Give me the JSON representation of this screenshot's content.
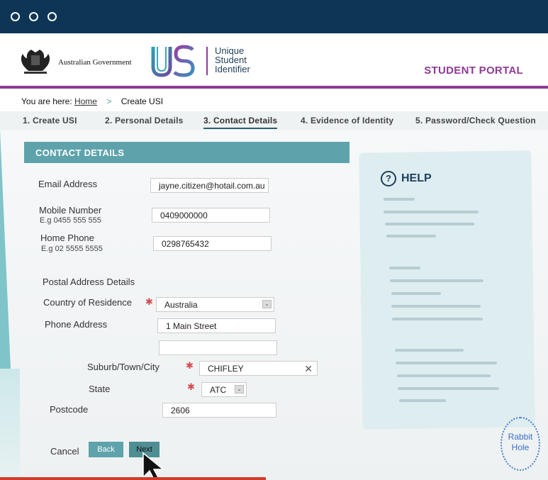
{
  "gov_label": "Australian Government",
  "logo": {
    "letters": "USI",
    "line1": "Unique",
    "line2": "Student",
    "line3": "Identifier"
  },
  "portal_title": "STUDENT PORTAL",
  "breadcrumb": {
    "prefix": "You are here:",
    "home": "Home",
    "separator": ">",
    "current": "Create USI"
  },
  "steps": [
    "1. Create USI",
    "2. Personal Details",
    "3. Contact Details",
    "4. Evidence of Identity",
    "5. Password/Check Question"
  ],
  "active_step": 2,
  "section_title": "CONTACT DETAILS",
  "form": {
    "email": {
      "label": "Email Address",
      "value": "jayne.citizen@hotail.com.au"
    },
    "mobile": {
      "label": "Mobile Number",
      "hint": "E.g 0455 555 555",
      "value": "0409000000"
    },
    "home_phone": {
      "label": "Home Phone",
      "hint": "E.g 02 5555 5555",
      "value": "0298765432"
    },
    "postal_heading": "Postal Address Details",
    "country": {
      "label": "Country of Residence",
      "value": "Australia"
    },
    "address": {
      "label": "Phone Address",
      "line1": "1 Main Street",
      "line2": ""
    },
    "suburb": {
      "label": "Suburb/Town/City",
      "value": "CHIFLEY"
    },
    "state": {
      "label": "State",
      "value": "ATC"
    },
    "postcode": {
      "label": "Postcode",
      "value": "2606"
    },
    "required_mark": "✱",
    "clear_symbol": "✕",
    "dropdown_symbol": "⌄"
  },
  "help": {
    "icon": "?",
    "title": "HELP"
  },
  "actions": {
    "cancel": "Cancel",
    "back": "Back",
    "next": "Next"
  },
  "watermark": {
    "line1": "Rabbit",
    "line2": "Hole"
  },
  "colors": {
    "titlebar": "#0d3656",
    "accent_purple": "#8e3a96",
    "teal": "#5ea3ab",
    "navy": "#1d3e5c"
  }
}
